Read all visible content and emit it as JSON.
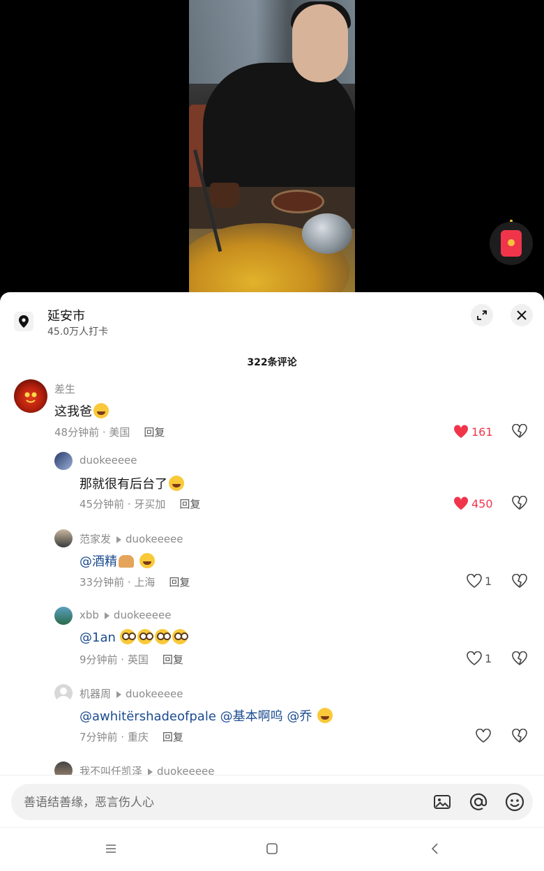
{
  "location": {
    "title": "延安市",
    "subtitle": "45.0万人打卡"
  },
  "comments_count_label": "322条评论",
  "comments": [
    {
      "author": "差生",
      "text": "这我爸",
      "time_loc": "48分钟前 · 美国",
      "reply_label": "回复",
      "likes": "161",
      "liked": true
    },
    {
      "author": "duokeeeee",
      "text": "那就很有后台了",
      "time_loc": "45分钟前 · 牙买加",
      "reply_label": "回复",
      "likes": "450",
      "liked": true
    },
    {
      "author": "范家发",
      "reply_to": "duokeeeee",
      "mention": "@酒精",
      "time_loc": "33分钟前 · 上海",
      "reply_label": "回复",
      "likes": "1",
      "liked": false
    },
    {
      "author": "xbb",
      "reply_to": "duokeeeee",
      "mention": "@1an",
      "time_loc": "9分钟前 · 英国",
      "reply_label": "回复",
      "likes": "1",
      "liked": false
    },
    {
      "author": "机器周",
      "reply_to": "duokeeeee",
      "mention1": "@awhitërshadeofpale",
      "mention2": "@基本啊呜",
      "mention3": "@乔",
      "time_loc": "7分钟前 · 重庆",
      "reply_label": "回复",
      "likes": "",
      "liked": false
    },
    {
      "author": "我不叫任凯泽",
      "reply_to": "duokeeeee"
    }
  ],
  "input": {
    "placeholder": "善语结善缘，恶言伤人心"
  },
  "colors": {
    "like_red": "#f0354b",
    "mention_blue": "#1a4b8f",
    "redpacket": "#f0354b"
  },
  "icons": [
    "location-pin-icon",
    "expand-icon",
    "close-icon",
    "heart-icon",
    "broken-heart-icon",
    "image-icon",
    "at-icon",
    "emoji-icon",
    "menu-icon",
    "home-icon",
    "back-icon",
    "red-packet-icon"
  ]
}
